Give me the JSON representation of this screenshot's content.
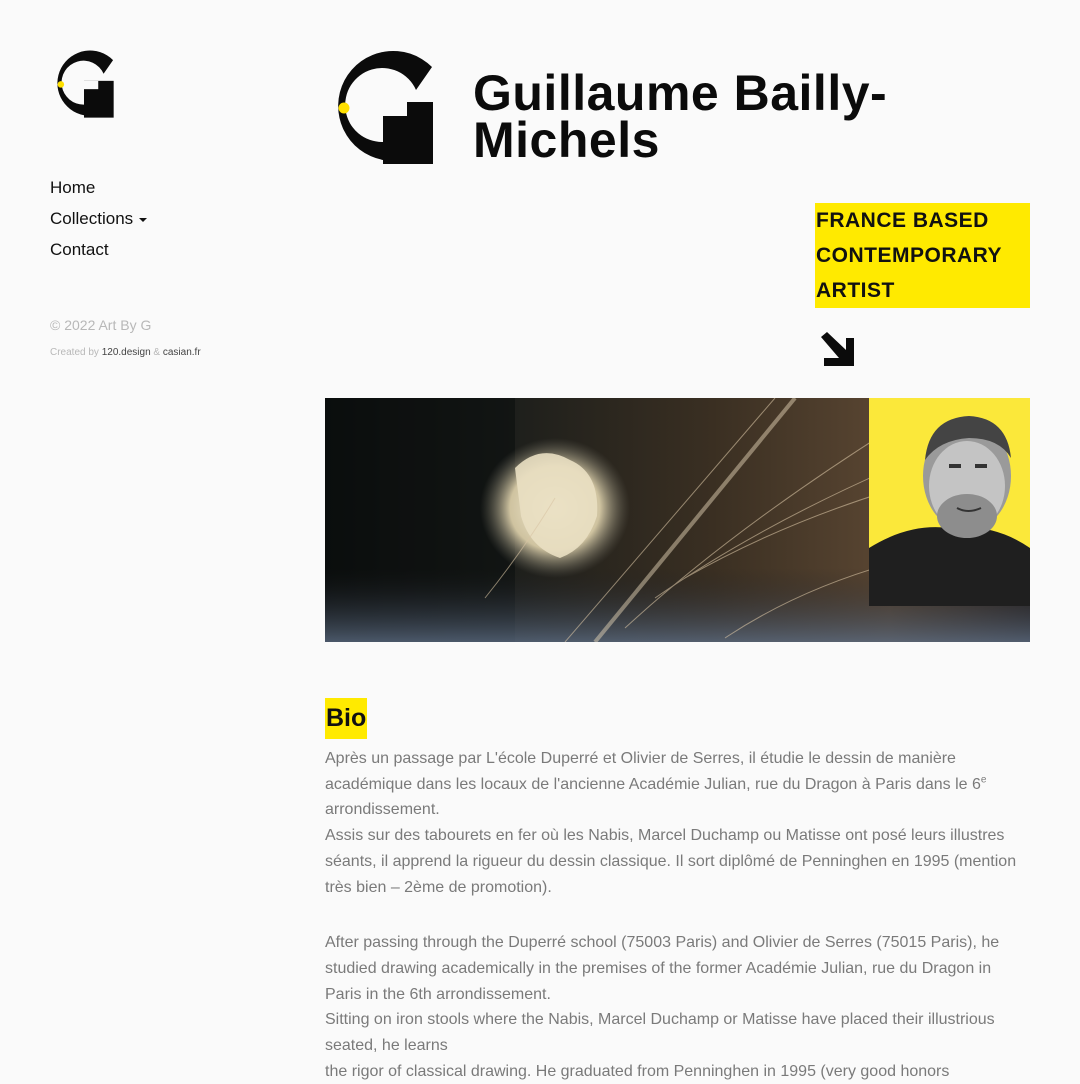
{
  "brand": {
    "logo_letter": "G"
  },
  "nav": {
    "items": [
      {
        "label": "Home"
      },
      {
        "label": "Collections",
        "has_dropdown": true
      },
      {
        "label": "Contact"
      }
    ]
  },
  "footer": {
    "copyright": "© 2022 Art By G",
    "created_by": "Created by",
    "link1": "120.design",
    "amp": "&",
    "link2": "casian.fr"
  },
  "header": {
    "title_line1": "Guillaume Bailly-",
    "title_line2": "Michels",
    "tagline_line1": "FRANCE BASED",
    "tagline_line2": "CONTEMPORARY",
    "tagline_line3": "ARTIST"
  },
  "bio": {
    "heading": "Bio",
    "fr_p1_a": "Après un passage par L'école Duperré et Olivier de Serres, il étudie le dessin de manière académique dans les locaux de l'ancienne Académie Julian, rue du Dragon à Paris dans le 6",
    "fr_p1_sup": "e",
    "fr_p1_b": " arrondissement.",
    "fr_p2": "Assis sur des tabourets en fer où les Nabis, Marcel Duchamp ou Matisse ont posé leurs illustres séants, il apprend la rigueur du dessin classique. Il sort diplômé de Penninghen en 1995 (mention très bien – 2ème de promotion).",
    "en_p1": "After passing through the Duperré school (75003 Paris) and Olivier de Serres (75015 Paris), he studied drawing academically in the premises of the former Académie Julian, rue du Dragon in Paris in the 6th arrondissement.",
    "en_p2": "Sitting on iron stools where the Nabis, Marcel Duchamp or Matisse have placed their illustrious seated, he learns",
    "en_p3": "the rigor of classical drawing. He graduated from Penninghen in 1995 (very good honors"
  },
  "colors": {
    "accent": "#ffea00",
    "text": "#111111",
    "muted": "#7a7a7a",
    "logo_dot": "#ffe000"
  },
  "icons": {
    "logo": "g-logo-icon",
    "arrow": "arrow-down-right-icon",
    "caret": "caret-down-icon"
  }
}
